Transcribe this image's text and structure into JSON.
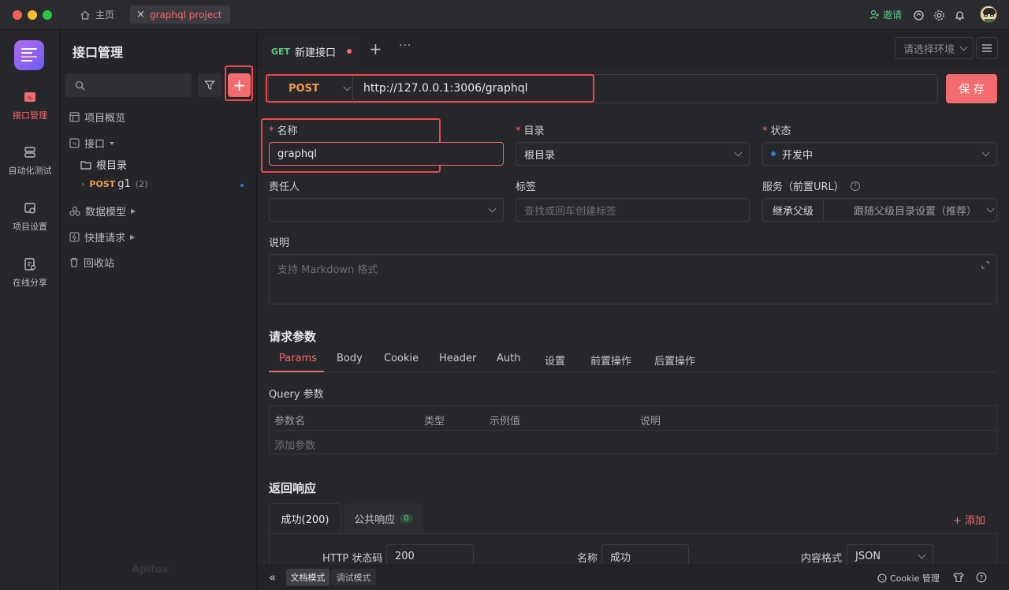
{
  "titlebar": {
    "home_tab": "主页",
    "project_tab": "graphql project",
    "invite": "邀请",
    "colors": {
      "accent": "#f46b70",
      "invite": "#5cc985"
    }
  },
  "leftnav": [
    {
      "label": "接口管理",
      "icon": "api-icon",
      "active": true
    },
    {
      "label": "自动化测试",
      "icon": "automation-icon",
      "active": false
    },
    {
      "label": "项目设置",
      "icon": "project-settings-icon",
      "active": false
    },
    {
      "label": "在线分享",
      "icon": "share-icon",
      "active": false
    }
  ],
  "sidebar": {
    "title": "接口管理",
    "search_placeholder": "",
    "tree": {
      "overview": "项目概览",
      "api": "接口",
      "root": "根目录",
      "item_method": "POST",
      "item_name": "g1",
      "item_count": "(2)",
      "data_model": "数据模型",
      "quick_request": "快捷请求",
      "trash": "回收站"
    },
    "watermark": "Apifox"
  },
  "request_tabs": {
    "active_method": "GET",
    "active_name": "新建接口",
    "env_placeholder": "请选择环境"
  },
  "urlbar": {
    "method": "POST",
    "url": "http://127.0.0.1:3006/graphql",
    "save": "保 存"
  },
  "form": {
    "name_label": "名称",
    "name_value": "graphql",
    "dir_label": "目录",
    "dir_value": "根目录",
    "status_label": "状态",
    "status_value": "开发中",
    "owner_label": "责任人",
    "tags_label": "标签",
    "tags_placeholder": "查找或回车创建标签",
    "service_label": "服务（前置URL）",
    "service_inherit": "继承父级",
    "service_value": "跟随父级目录设置（推荐）",
    "desc_label": "说明",
    "desc_placeholder": "支持 Markdown 格式"
  },
  "params": {
    "title": "请求参数",
    "tabs": [
      "Params",
      "Body",
      "Cookie",
      "Header",
      "Auth",
      "设置",
      "前置操作",
      "后置操作"
    ],
    "query_label": "Query 参数",
    "columns": [
      "参数名",
      "类型",
      "示例值",
      "说明"
    ],
    "add_placeholder": "添加参数"
  },
  "response": {
    "title": "返回响应",
    "tab_success": "成功(200)",
    "tab_common": "公共响应",
    "tab_common_count": "0",
    "add": "+ 添加",
    "http_code_label": "HTTP 状态码",
    "http_code_value": "200",
    "name_label": "名称",
    "name_value": "成功",
    "format_label": "内容格式",
    "format_value": "JSON"
  },
  "bottombar": {
    "doc_mode": "文档模式",
    "debug_mode": "调试模式",
    "cookie": "Cookie 管理"
  }
}
